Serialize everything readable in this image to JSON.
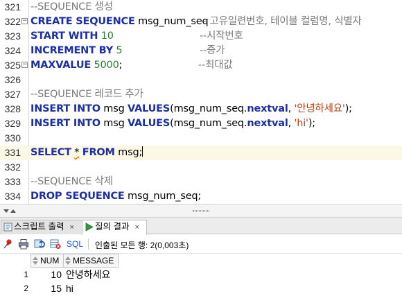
{
  "editor": {
    "lines": [
      {
        "n": "321",
        "fold": false,
        "comment": "--SEQUENCE 생성"
      },
      {
        "n": "322",
        "fold": true,
        "kw1": "CREATE SEQUENCE",
        "txt1": " msg_num_seq",
        "comment": "-- 고유일련번호, 테이블 컬럼명, 식별자"
      },
      {
        "n": "323",
        "fold": false,
        "kw1": "START WITH",
        "num": " 10",
        "comment": "--시작번호"
      },
      {
        "n": "324",
        "fold": false,
        "kw1": "INCREMENT BY",
        "num": " 5",
        "comment": "--증가"
      },
      {
        "n": "325",
        "fold": true,
        "kw1": "MAXVALUE",
        "num": " 5000",
        "txt2": ";",
        "comment": "--최대값"
      },
      {
        "n": "326",
        "fold": false
      },
      {
        "n": "327",
        "fold": false,
        "comment": "--SEQUENCE 레코드 추가"
      },
      {
        "n": "328",
        "fold": false,
        "kw1": "INSERT INTO",
        "txt1": " msg ",
        "kw2": "VALUES",
        "txt2": "(msg_num_seq.",
        "kw3": "nextval",
        "txt3": ", ",
        "str": "'안녕하세요'",
        "txt4": ");"
      },
      {
        "n": "329",
        "fold": false,
        "kw1": "INSERT INTO",
        "txt1": " msg ",
        "kw2": "VALUES",
        "txt2": "(msg_num_seq.",
        "kw3": "nextval",
        "txt3": ", ",
        "str": "'hi'",
        "txt4": ");"
      },
      {
        "n": "330",
        "fold": false
      },
      {
        "n": "331",
        "fold": false,
        "kw1": "SELECT",
        "txt1": " ",
        "squig": "*",
        "txt2": " ",
        "kw2": "FROM",
        "txt3": " msg;"
      },
      {
        "n": "332",
        "fold": false
      },
      {
        "n": "333",
        "fold": false,
        "comment": "--SEQUENCE 삭제"
      },
      {
        "n": "334",
        "fold": false,
        "kw1": "DROP SEQUENCE",
        "txt1": " msg_num_seq;"
      }
    ]
  },
  "tabs": [
    {
      "label": "스크립트 출력",
      "close": "×",
      "icon": "script-output-icon",
      "active": false
    },
    {
      "label": "질의 결과",
      "close": "×",
      "icon": "query-result-icon",
      "active": true
    }
  ],
  "toolbar": {
    "sql_label": "SQL",
    "status": "인출된 모든 행: 2(0,003초)"
  },
  "grid": {
    "columns": [
      "NUM",
      "MESSAGE"
    ],
    "rows": [
      {
        "rownum": "1",
        "num": "10",
        "message": "안녕하세요"
      },
      {
        "rownum": "2",
        "num": "15",
        "message": "hi"
      }
    ]
  },
  "colors": {
    "keyword": "#1c2fa6",
    "number": "#2e7d32",
    "string": "#b8420f",
    "comment": "#7a7a7a",
    "current_line": "#fdf8e6"
  }
}
